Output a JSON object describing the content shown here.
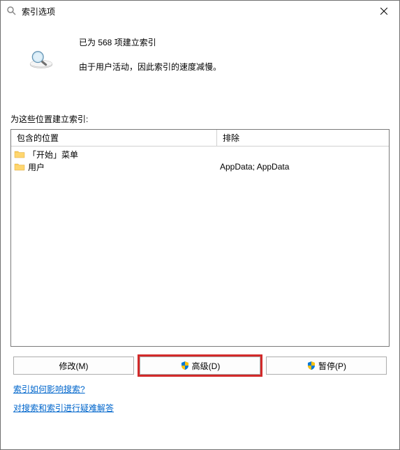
{
  "window": {
    "title": "索引选项"
  },
  "status": {
    "line1": "已为 568 项建立索引",
    "line2": "由于用户活动，因此索引的速度减慢。"
  },
  "locations": {
    "label": "为这些位置建立索引:",
    "header_included": "包含的位置",
    "header_excluded": "排除",
    "items": [
      {
        "name": "「开始」菜单",
        "excluded": ""
      },
      {
        "name": "用户",
        "excluded": "AppData; AppData"
      }
    ]
  },
  "buttons": {
    "modify": "修改(M)",
    "advanced": "高级(D)",
    "pause": "暂停(P)"
  },
  "links": {
    "how_affects": "索引如何影响搜索?",
    "troubleshoot": "对搜索和索引进行疑难解答"
  }
}
